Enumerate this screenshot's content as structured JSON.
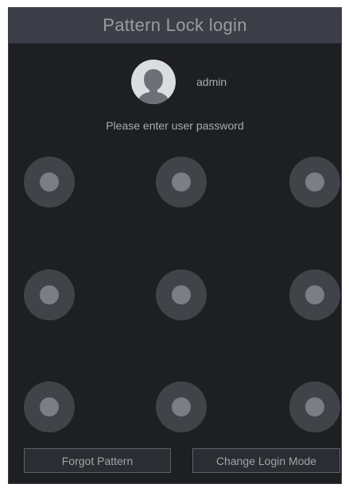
{
  "dialog": {
    "title": "Pattern Lock login"
  },
  "user": {
    "name": "admin",
    "avatar_icon": "user-avatar-icon"
  },
  "prompt": "Please enter user password",
  "pattern": {
    "rows": 3,
    "cols": 3,
    "nodes": [
      {
        "id": 1
      },
      {
        "id": 2
      },
      {
        "id": 3
      },
      {
        "id": 4
      },
      {
        "id": 5
      },
      {
        "id": 6
      },
      {
        "id": 7
      },
      {
        "id": 8
      },
      {
        "id": 9
      }
    ]
  },
  "buttons": {
    "forgot_label": "Forgot Pattern",
    "change_mode_label": "Change Login Mode"
  },
  "colors": {
    "background": "#1d1f23",
    "title_bar": "#3c3f47",
    "node_outer": "#414349",
    "node_inner": "#7c7e84"
  }
}
